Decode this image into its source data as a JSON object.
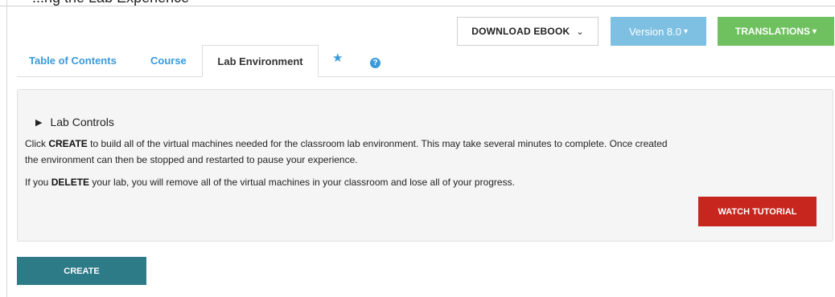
{
  "header": {
    "caption": "...ng the Lab Experience",
    "download_label": "DOWNLOAD EBOOK",
    "download_chevron": "⌄",
    "version_label": "Version 8.0",
    "translations_label": "TRANSLATIONS",
    "dropdown_caret": "▾"
  },
  "tabs": {
    "toc": "Table of Contents",
    "course": "Course",
    "lab": "Lab Environment",
    "star_glyph": "★",
    "help_glyph": "?"
  },
  "panel": {
    "toggle_glyph": "▶",
    "summary": "Lab Controls",
    "p1_before": "Click ",
    "p1_bold": "CREATE",
    "p1_line1_rest": " to build all of the virtual machines needed for the classroom lab environment. This may take several minutes to complete. Once created",
    "p1_line2": "the environment can then be stopped and restarted to pause your experience.",
    "p2_before": "If you ",
    "p2_bold": "DELETE",
    "p2_after": " your lab, you will remove all of the virtual machines in your classroom and lose all of your progress.",
    "tutorial_label": "WATCH TUTORIAL"
  },
  "actions": {
    "create_label": "CREATE"
  },
  "colors": {
    "link_blue": "#3a9ad9",
    "version_blue": "#7ec0e1",
    "translations_green": "#6fc05f",
    "tutorial_red": "#c6261e",
    "create_teal": "#2e7b88"
  }
}
